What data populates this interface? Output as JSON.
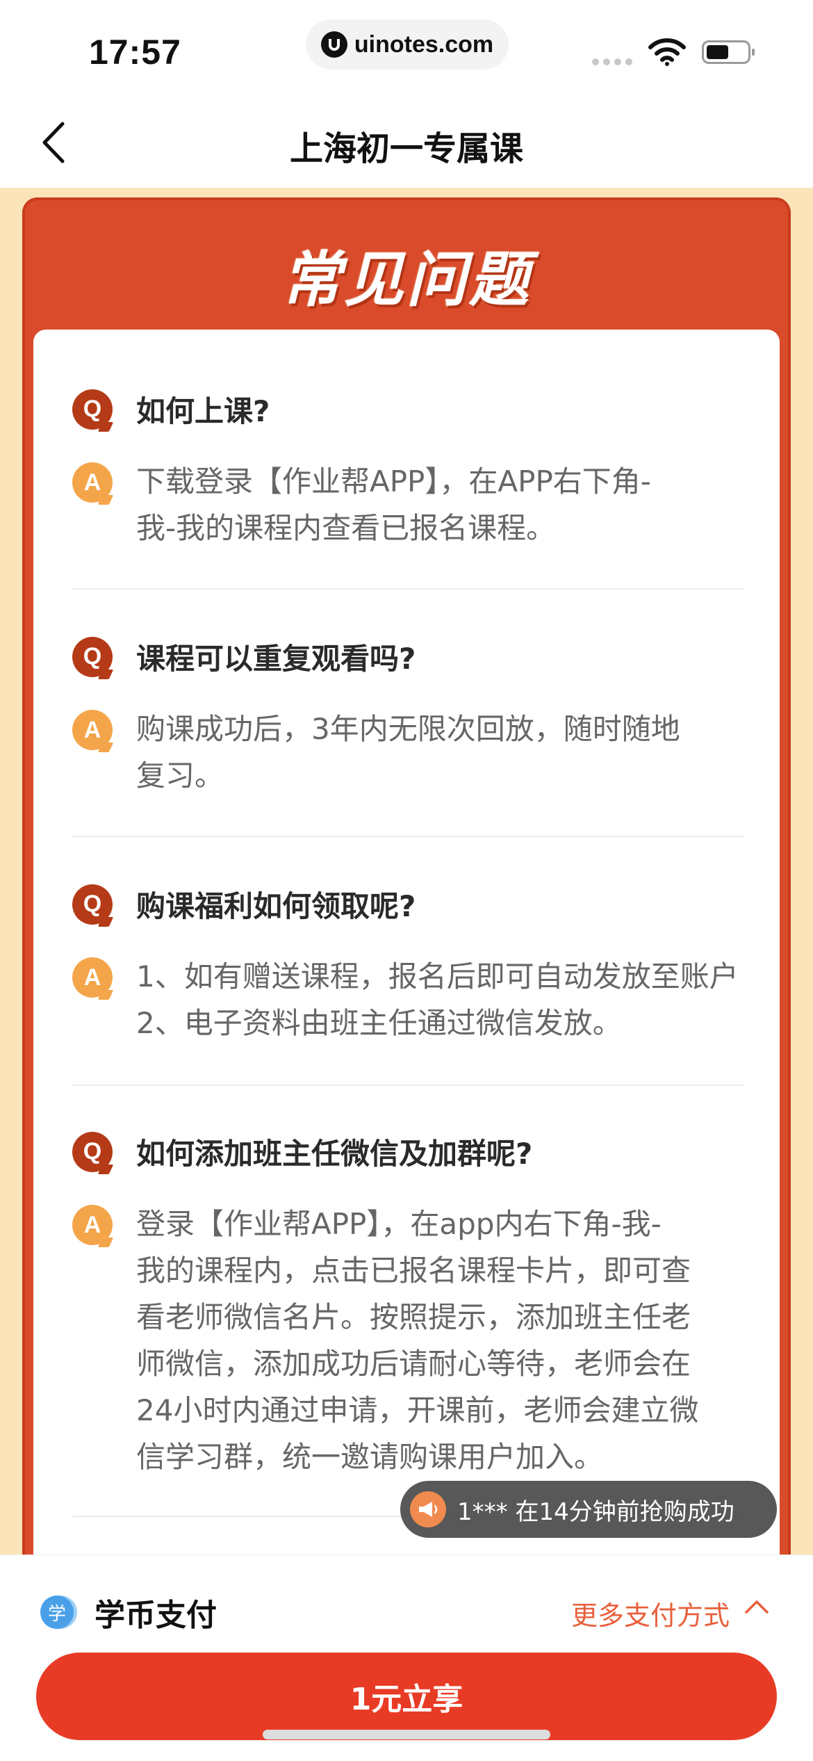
{
  "status_bar": {
    "time": "17:57",
    "url": "uinotes.com"
  },
  "nav": {
    "title": "上海初一专属课"
  },
  "faq": {
    "heading": "常见问题",
    "q_badge": "Q",
    "a_badge": "A",
    "items": [
      {
        "question": "如何上课?",
        "answer": "下载登录【作业帮APP】，在APP右下角-\n我-我的课程内查看已报名课程。"
      },
      {
        "question": "课程可以重复观看吗?",
        "answer": "购课成功后，3年内无限次回放，随时随地\n复习。"
      },
      {
        "question": "购课福利如何领取呢?",
        "answer": "1、如有赠送课程，报名后即可自动发放至账户\n2、电子资料由班主任通过微信发放。"
      },
      {
        "question": "如何添加班主任微信及加群呢?",
        "answer": "登录【作业帮APP】，在app内右下角-我-\n我的课程内，点击已报名课程卡片，即可查\n看老师微信名片。按照提示，添加班主任老\n师微信，添加成功后请耐心等待，老师会在\n24小时内通过申请，开课前，老师会建立微\n信学习群，统一邀请购课用户加入。"
      }
    ]
  },
  "toast": {
    "text": "1*** 在14分钟前抢购成功"
  },
  "payment": {
    "coin_icon_label": "学",
    "method_label": "学币支付",
    "more_label": "更多支付方式",
    "buy_label": "1元立享"
  },
  "colors": {
    "card_red": "#d94b2a",
    "button_red": "#e83b25",
    "q_badge": "#b53a17",
    "a_badge": "#f4a54a",
    "page_bg": "#fbe4b8",
    "accent_text": "#e8603c"
  }
}
